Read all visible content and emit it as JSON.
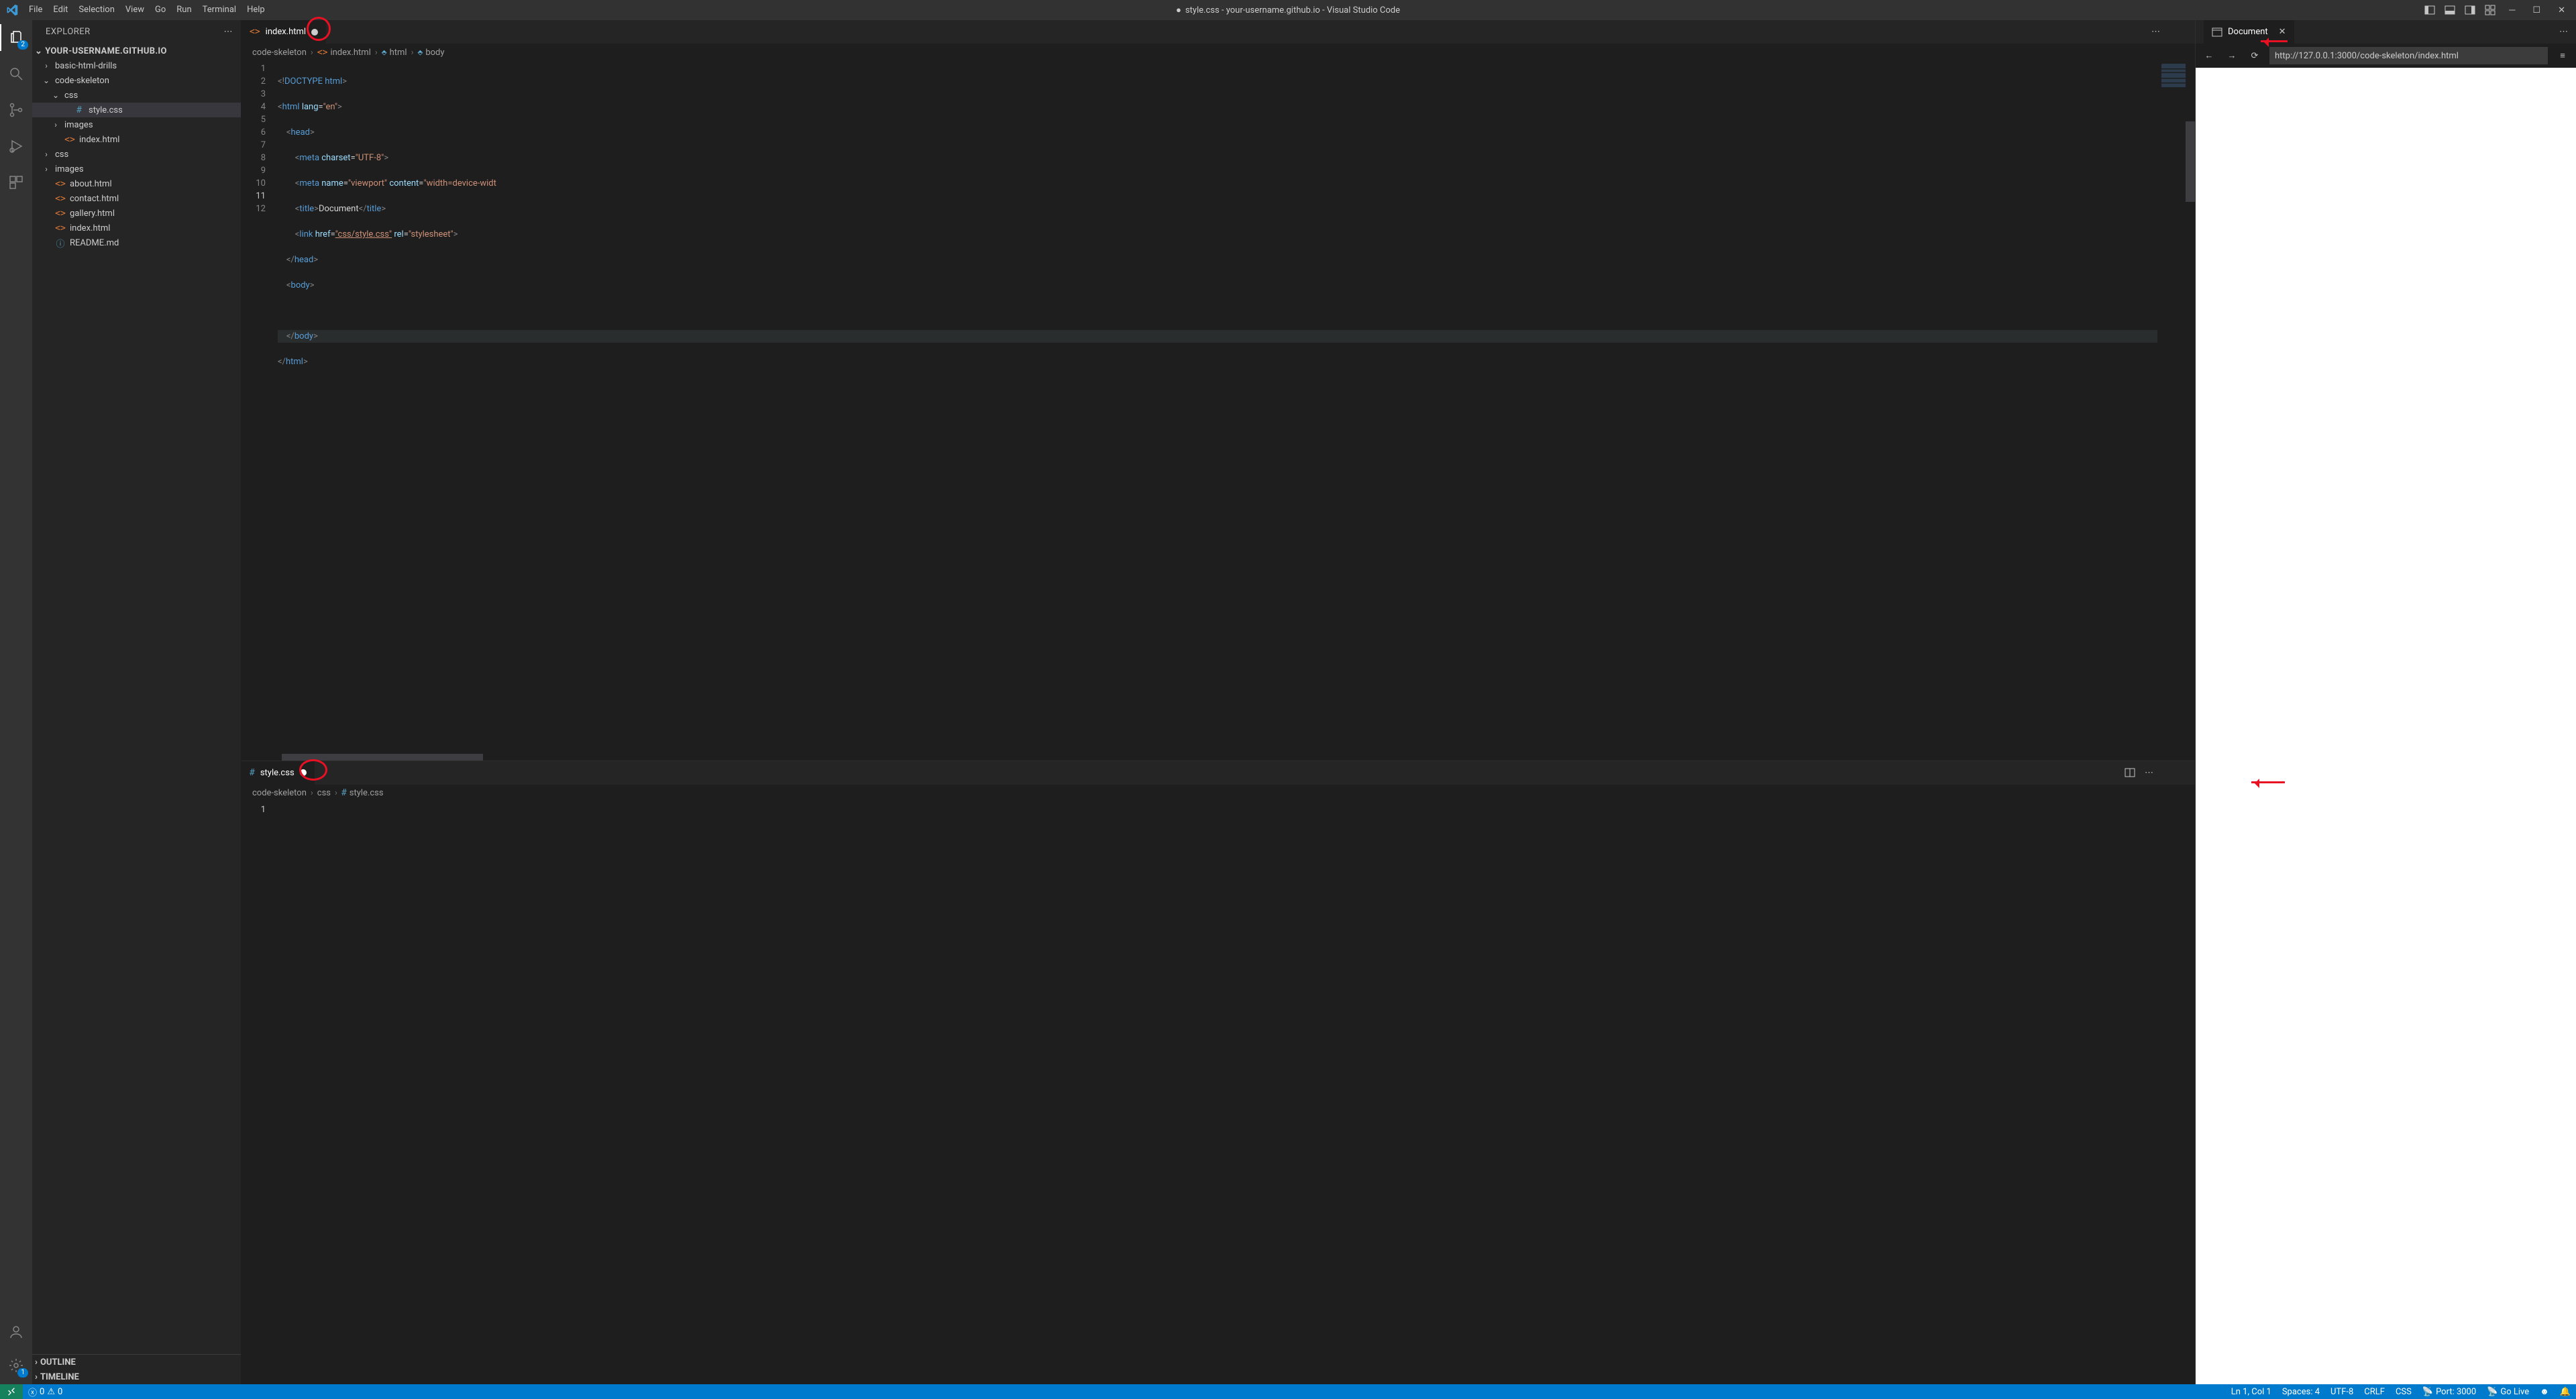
{
  "titlebar": {
    "menus": [
      "File",
      "Edit",
      "Selection",
      "View",
      "Go",
      "Run",
      "Terminal",
      "Help"
    ],
    "dirty_indicator": "●",
    "title": "style.css - your-username.github.io - Visual Studio Code"
  },
  "activitybar": {
    "explorer_badge": "2",
    "settings_badge": "1"
  },
  "sidebar": {
    "title": "EXPLORER",
    "project": "YOUR-USERNAME.GITHUB.IO",
    "tree": [
      {
        "depth": 1,
        "chev": ">",
        "icon": "",
        "label": "basic-html-drills"
      },
      {
        "depth": 1,
        "chev": "v",
        "icon": "",
        "label": "code-skeleton"
      },
      {
        "depth": 2,
        "chev": "v",
        "icon": "",
        "label": "css"
      },
      {
        "depth": 3,
        "chev": "",
        "icon": "hash",
        "label": "style.css",
        "selected": true
      },
      {
        "depth": 2,
        "chev": ">",
        "icon": "",
        "label": "images"
      },
      {
        "depth": 2,
        "chev": "",
        "icon": "tag",
        "label": "index.html"
      },
      {
        "depth": 1,
        "chev": ">",
        "icon": "",
        "label": "css"
      },
      {
        "depth": 1,
        "chev": ">",
        "icon": "",
        "label": "images"
      },
      {
        "depth": 1,
        "chev": "",
        "icon": "tag",
        "label": "about.html"
      },
      {
        "depth": 1,
        "chev": "",
        "icon": "tag",
        "label": "contact.html"
      },
      {
        "depth": 1,
        "chev": "",
        "icon": "tag",
        "label": "gallery.html"
      },
      {
        "depth": 1,
        "chev": "",
        "icon": "tag",
        "label": "index.html"
      },
      {
        "depth": 1,
        "chev": "",
        "icon": "info",
        "label": "README.md"
      }
    ],
    "panels": {
      "outline": "OUTLINE",
      "timeline": "TIMELINE"
    }
  },
  "editor_top": {
    "tab": {
      "icon": "<>",
      "name": "index.html",
      "dirty": true
    },
    "breadcrumb": [
      "code-skeleton",
      "index.html",
      "html",
      "body"
    ],
    "lines": [
      "1",
      "2",
      "3",
      "4",
      "5",
      "6",
      "7",
      "8",
      "9",
      "10",
      "11",
      "12"
    ],
    "code": {
      "l1_a": "<!",
      "l1_b": "DOCTYPE",
      "l1_c": " html",
      "l1_d": ">",
      "l2_a": "<",
      "l2_b": "html",
      "l2_c": " lang",
      "l2_d": "=",
      "l2_e": "\"en\"",
      "l2_f": ">",
      "l3_a": "    <",
      "l3_b": "head",
      "l3_c": ">",
      "l4_a": "        <",
      "l4_b": "meta",
      "l4_c": " charset",
      "l4_d": "=",
      "l4_e": "\"UTF-8\"",
      "l4_f": ">",
      "l5_a": "        <",
      "l5_b": "meta",
      "l5_c": " name",
      "l5_d": "=",
      "l5_e": "\"viewport\"",
      "l5_f": " content",
      "l5_g": "=",
      "l5_h": "\"width=device-widt",
      "l6_a": "        <",
      "l6_b": "title",
      "l6_c": ">",
      "l6_d": "Document",
      "l6_e": "</",
      "l6_f": "title",
      "l6_g": ">",
      "l7_a": "        <",
      "l7_b": "link",
      "l7_c": " href",
      "l7_d": "=",
      "l7_e": "\"css/style.css\"",
      "l7_f": " rel",
      "l7_g": "=",
      "l7_h": "\"stylesheet\"",
      "l7_i": ">",
      "l8_a": "    </",
      "l8_b": "head",
      "l8_c": ">",
      "l9_a": "    <",
      "l9_b": "body",
      "l9_c": ">",
      "l10_a": "    ",
      "l11_a": "    </",
      "l11_b": "body",
      "l11_c": ">",
      "l12_a": "</",
      "l12_b": "html",
      "l12_c": ">"
    }
  },
  "editor_bottom": {
    "tab": {
      "icon": "#",
      "name": "style.css",
      "dirty": true
    },
    "breadcrumb": [
      "code-skeleton",
      "css",
      "style.css"
    ],
    "lines": [
      "1"
    ]
  },
  "preview": {
    "tab_label": "Document",
    "url": "http://127.0.0.1:3000/code-skeleton/index.html"
  },
  "status": {
    "errors": "0",
    "warnings": "0",
    "ln_col": "Ln 1, Col 1",
    "spaces": "Spaces: 4",
    "encoding": "UTF-8",
    "eol": "CRLF",
    "lang": "CSS",
    "port": "Port: 3000",
    "golive": "Go Live"
  }
}
